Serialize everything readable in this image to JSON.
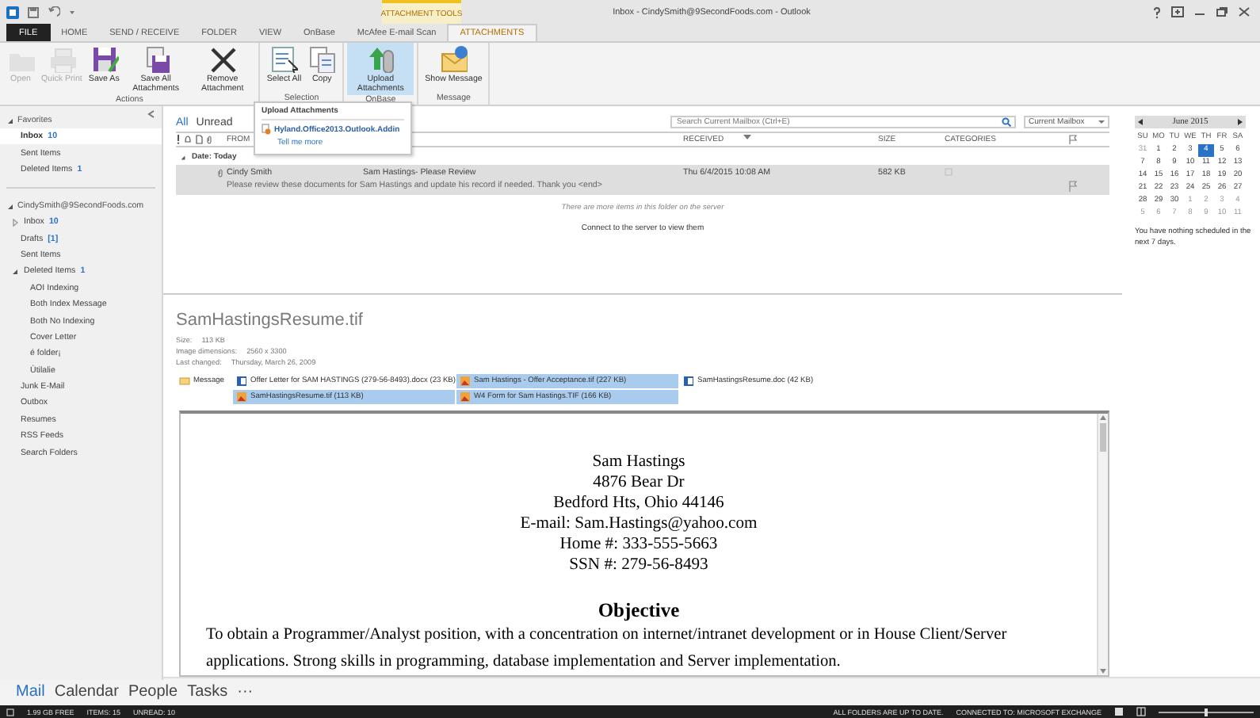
{
  "window": {
    "title": "Inbox - CindySmith@9SecondFoods.com - Outlook",
    "context_group": "ATTACHMENT TOOLS"
  },
  "ribbon_tabs": [
    {
      "label": "FILE",
      "kind": "file",
      "selected": false
    },
    {
      "label": "HOME",
      "kind": "tab",
      "selected": false
    },
    {
      "label": "SEND / RECEIVE",
      "kind": "tab",
      "selected": false
    },
    {
      "label": "FOLDER",
      "kind": "tab",
      "selected": false
    },
    {
      "label": "VIEW",
      "kind": "tab",
      "selected": false
    },
    {
      "label": "OnBase",
      "kind": "tab",
      "selected": false
    },
    {
      "label": "McAfee E-mail Scan",
      "kind": "tab",
      "selected": false
    },
    {
      "label": "ATTACHMENTS",
      "kind": "contextual",
      "selected": true
    }
  ],
  "ribbon_groups": [
    {
      "label": "Actions",
      "buttons": [
        {
          "label": "Open",
          "kind": "folder",
          "disabled": true,
          "highlighted": false
        },
        {
          "label": "Quick Print",
          "kind": "printer",
          "disabled": true,
          "highlighted": false
        },
        {
          "label": "Save As",
          "kind": "disk",
          "disabled": false,
          "highlighted": false
        },
        {
          "label": "Save All Attachments",
          "kind": "disks",
          "disabled": false,
          "highlighted": false
        },
        {
          "label": "Remove Attachment",
          "kind": "cross",
          "disabled": false,
          "highlighted": false
        }
      ]
    },
    {
      "label": "Selection",
      "buttons": [
        {
          "label": "Select All",
          "kind": "select",
          "disabled": false,
          "highlighted": false
        },
        {
          "label": "Copy",
          "kind": "copy",
          "disabled": false,
          "highlighted": false
        }
      ]
    },
    {
      "label": "OnBase",
      "buttons": [
        {
          "label": "Upload Attachments",
          "kind": "upload",
          "disabled": false,
          "highlighted": true
        }
      ]
    },
    {
      "label": "Message",
      "buttons": [
        {
          "label": "Show Message",
          "kind": "envelope",
          "disabled": false,
          "highlighted": false
        }
      ]
    }
  ],
  "tooltip": {
    "title": "Upload Attachments",
    "item": "Hyland.Office2013.Outlook.Addin",
    "link": "Tell me more"
  },
  "sidebar": {
    "sections": [
      {
        "label": "Favorites",
        "expanded": true,
        "items": [
          {
            "label": "Inbox",
            "count": "10",
            "selected": true
          },
          {
            "label": "Sent Items",
            "selected": false
          },
          {
            "label": "Deleted Items",
            "count": "1",
            "selected": false
          }
        ]
      },
      {
        "label": "CindySmith@9SecondFoods.com",
        "expanded": true,
        "items": [
          {
            "label": "Inbox",
            "count": "10",
            "selected": false,
            "expanded": false
          },
          {
            "label": "Drafts",
            "count": "[1]",
            "selected": false
          },
          {
            "label": "Sent Items",
            "selected": false
          },
          {
            "label": "Deleted Items",
            "count": "1",
            "selected": false,
            "expanded": true,
            "children": [
              {
                "label": "AOI Indexing",
                "selected": false
              },
              {
                "label": "Both Index Message",
                "selected": false
              },
              {
                "label": "Both No Indexing",
                "selected": false
              },
              {
                "label": "Cover Letter",
                "selected": false
              },
              {
                "label": "é folder¡",
                "selected": false
              },
              {
                "label": "Ùtilalie",
                "selected": false
              }
            ]
          },
          {
            "label": "Junk E-Mail",
            "selected": false
          },
          {
            "label": "Outbox",
            "selected": false
          },
          {
            "label": "Resumes",
            "selected": false
          },
          {
            "label": "RSS Feeds",
            "selected": false
          },
          {
            "label": "Search Folders",
            "selected": false
          }
        ]
      }
    ]
  },
  "message_list": {
    "filters": [
      {
        "label": "All",
        "selected": true
      },
      {
        "label": "Unread",
        "selected": false
      }
    ],
    "search": {
      "placeholder": "Search Current Mailbox (Ctrl+E)"
    },
    "scope": "Current Mailbox",
    "columns": [
      "FROM",
      "RECEIVED",
      "SIZE",
      "CATEGORIES"
    ],
    "group": "Date: Today",
    "messages": [
      {
        "from": "Cindy Smith",
        "subject": "Sam Hastings- Please Review",
        "received": "Thu 6/4/2015 10:08 AM",
        "size": "582 KB",
        "preview": "Please review these documents for Sam Hastings and update his record if needed. Thank you <end>",
        "selected": true
      }
    ],
    "notice": "There are more items in this folder on the server",
    "connect_link": "Connect to the server to view them"
  },
  "reading_pane": {
    "file_name": "SamHastingsResume.tif",
    "details": [
      {
        "label": "Size:",
        "value": "113 KB"
      },
      {
        "label": "Image dimensions:",
        "value": "2560 x 3300"
      },
      {
        "label": "Last changed:",
        "value": "Thursday, March 26, 2009"
      }
    ],
    "attachments": [
      {
        "label": "Message",
        "kind": "message",
        "selected": false
      },
      {
        "label": "Offer Letter for SAM HASTINGS (279-56-8493).docx (23 KB)",
        "kind": "word",
        "selected": false
      },
      {
        "label": "Sam Hastings - Offer Acceptance.tif (227 KB)",
        "kind": "image",
        "selected": true
      },
      {
        "label": "SamHastingsResume.doc (42 KB)",
        "kind": "word",
        "selected": false
      },
      {
        "label": "SamHastingsResume.tif (113 KB)",
        "kind": "image",
        "selected": true
      },
      {
        "label": "W4 Form for Sam Hastings.TIF (166 KB)",
        "kind": "image",
        "selected": true
      }
    ],
    "document": {
      "address_lines": [
        "Sam Hastings",
        "4876 Bear Dr",
        "Bedford Hts, Ohio 44146",
        "E-mail: Sam.Hastings@yahoo.com",
        "Home #: 333-555-5663",
        "SSN #: 279-56-8493"
      ],
      "heading": "Objective",
      "paragraph": "To obtain a Programmer/Analyst position, with a concentration on internet/intranet development or in House Client/Server applications. Strong skills in programming, database implementation and Server implementation."
    }
  },
  "calendar": {
    "month": "June 2015",
    "weekdays": [
      "SU",
      "MO",
      "TU",
      "WE",
      "TH",
      "FR",
      "SA"
    ],
    "weeks": [
      [
        {
          "day": "31",
          "current_month": false,
          "selected": false
        },
        {
          "day": "1",
          "current_month": true,
          "selected": false
        },
        {
          "day": "2",
          "current_month": true,
          "selected": false
        },
        {
          "day": "3",
          "current_month": true,
          "selected": false
        },
        {
          "day": "4",
          "current_month": true,
          "selected": true
        },
        {
          "day": "5",
          "current_month": true,
          "selected": false
        },
        {
          "day": "6",
          "current_month": true,
          "selected": false
        }
      ],
      [
        {
          "day": "7",
          "current_month": true,
          "selected": false
        },
        {
          "day": "8",
          "current_month": true,
          "selected": false
        },
        {
          "day": "9",
          "current_month": true,
          "selected": false
        },
        {
          "day": "10",
          "current_month": true,
          "selected": false
        },
        {
          "day": "11",
          "current_month": true,
          "selected": false
        },
        {
          "day": "12",
          "current_month": true,
          "selected": false
        },
        {
          "day": "13",
          "current_month": true,
          "selected": false
        }
      ],
      [
        {
          "day": "14",
          "current_month": true,
          "selected": false
        },
        {
          "day": "15",
          "current_month": true,
          "selected": false
        },
        {
          "day": "16",
          "current_month": true,
          "selected": false
        },
        {
          "day": "17",
          "current_month": true,
          "selected": false
        },
        {
          "day": "18",
          "current_month": true,
          "selected": false
        },
        {
          "day": "19",
          "current_month": true,
          "selected": false
        },
        {
          "day": "20",
          "current_month": true,
          "selected": false
        }
      ],
      [
        {
          "day": "21",
          "current_month": true,
          "selected": false
        },
        {
          "day": "22",
          "current_month": true,
          "selected": false
        },
        {
          "day": "23",
          "current_month": true,
          "selected": false
        },
        {
          "day": "24",
          "current_month": true,
          "selected": false
        },
        {
          "day": "25",
          "current_month": true,
          "selected": false
        },
        {
          "day": "26",
          "current_month": true,
          "selected": false
        },
        {
          "day": "27",
          "current_month": true,
          "selected": false
        }
      ],
      [
        {
          "day": "28",
          "current_month": true,
          "selected": false
        },
        {
          "day": "29",
          "current_month": true,
          "selected": false
        },
        {
          "day": "30",
          "current_month": true,
          "selected": false
        },
        {
          "day": "1",
          "current_month": false,
          "selected": false
        },
        {
          "day": "2",
          "current_month": false,
          "selected": false
        },
        {
          "day": "3",
          "current_month": false,
          "selected": false
        },
        {
          "day": "4",
          "current_month": false,
          "selected": false
        }
      ],
      [
        {
          "day": "5",
          "current_month": false,
          "selected": false
        },
        {
          "day": "6",
          "current_month": false,
          "selected": false
        },
        {
          "day": "7",
          "current_month": false,
          "selected": false
        },
        {
          "day": "8",
          "current_month": false,
          "selected": false
        },
        {
          "day": "9",
          "current_month": false,
          "selected": false
        },
        {
          "day": "10",
          "current_month": false,
          "selected": false
        },
        {
          "day": "11",
          "current_month": false,
          "selected": false
        }
      ]
    ],
    "agenda": "You have nothing scheduled in the next 7 days."
  },
  "navigation": [
    {
      "label": "Mail",
      "selected": true
    },
    {
      "label": "Calendar",
      "selected": false
    },
    {
      "label": "People",
      "selected": false
    },
    {
      "label": "Tasks",
      "selected": false
    },
    {
      "label": "···",
      "selected": false
    }
  ],
  "status_bar": {
    "left": [
      "1.99 GB FREE",
      "ITEMS: 15",
      "UNREAD: 10"
    ],
    "right": [
      "ALL FOLDERS ARE UP TO DATE.",
      "CONNECTED TO: MICROSOFT EXCHANGE"
    ],
    "zoom": {
      "level": 0.5
    }
  }
}
